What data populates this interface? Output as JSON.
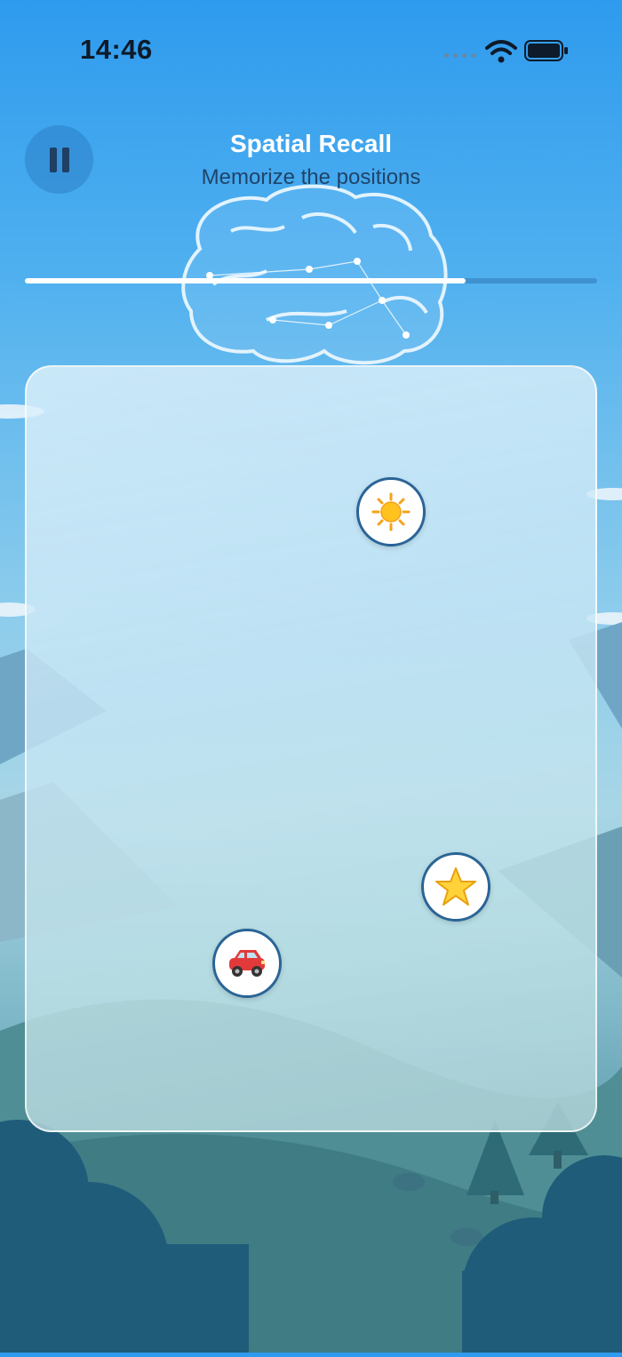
{
  "status": {
    "time": "14:46"
  },
  "header": {
    "title": "Spatial Recall",
    "subtitle": "Memorize the positions"
  },
  "progress": {
    "fraction": 0.77
  },
  "board": {
    "tokens": [
      {
        "icon": "sun-icon"
      },
      {
        "icon": "star-icon"
      },
      {
        "icon": "car-icon"
      }
    ]
  },
  "colors": {
    "accent": "#2a6496",
    "progress_fill": "#ffffff",
    "title": "#ffffff",
    "subtitle": "#1f4468"
  }
}
